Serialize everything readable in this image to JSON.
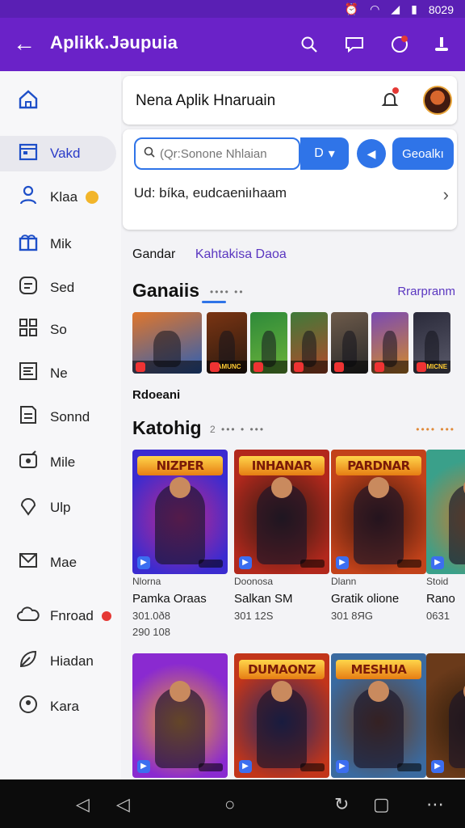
{
  "status_bar": {
    "time": "8029"
  },
  "app_bar": {
    "title": "Aplikk.Jəupuia"
  },
  "sidebar": {
    "items": [
      {
        "label": "",
        "icon": "home-icon"
      },
      {
        "label": "Vakd",
        "icon": "calendar-icon",
        "active": true
      },
      {
        "label": "Klaa",
        "icon": "person-icon",
        "dot": "#f2b52a"
      },
      {
        "label": "Mik",
        "icon": "gift-icon"
      },
      {
        "label": "Sed",
        "icon": "chat-icon"
      },
      {
        "label": "So",
        "icon": "grid-icon"
      },
      {
        "label": "Ne",
        "icon": "list-icon"
      },
      {
        "label": "Sonnd",
        "icon": "document-icon"
      },
      {
        "label": "Mile",
        "icon": "tv-icon"
      },
      {
        "label": "Ulp",
        "icon": "pin-icon"
      },
      {
        "label": "Mae",
        "icon": "mail-icon"
      },
      {
        "label": "Fnroad",
        "icon": "cloud-icon",
        "dot": "#e53935"
      },
      {
        "label": "Hiadan",
        "icon": "leaf-icon"
      },
      {
        "label": "Kara",
        "icon": "location-icon"
      }
    ]
  },
  "header_card": {
    "title": "Nena Aplik Hnaruain"
  },
  "search": {
    "placeholder": "(Qr:Sonone Nhlaian",
    "dropdown_label": "D",
    "primary_button": "Geoalkı",
    "suggestion": "Ud: bíka, eudcaeniıhaam"
  },
  "chips": {
    "first": "Gandar",
    "second": "Kahtakisa Daoa"
  },
  "section_games": {
    "heading": "Ganaiis",
    "sub": "•••• ••",
    "more": "Rrarpranm"
  },
  "thumbnails": [
    {
      "caption": "",
      "bg1": "#e0762b",
      "bg2": "#2c5fb5"
    },
    {
      "caption": "SAMUNC",
      "bg1": "#7a3412",
      "bg2": "#2b1a10"
    },
    {
      "caption": "",
      "bg1": "#2e8a3a",
      "bg2": "#6bb23a"
    },
    {
      "caption": "",
      "bg1": "#3f7a3a",
      "bg2": "#b24a2a"
    },
    {
      "caption": "",
      "bg1": "#6d5a4a",
      "bg2": "#2a2a2a"
    },
    {
      "caption": "",
      "bg1": "#7a4ab5",
      "bg2": "#d28a2a"
    },
    {
      "caption": "JIUMICNE",
      "bg1": "#2a2a3a",
      "bg2": "#5a5a6a"
    }
  ],
  "recent_label": "Rdoeani",
  "section_catalog": {
    "heading": "Katohig",
    "sub": "2 ••• • •••",
    "sub_right": "•••• •••"
  },
  "games": [
    {
      "logo": "NIZPER",
      "category": "Nlorna",
      "name": "Pamka Oraas",
      "downloads": "301.0ð8",
      "size": "290 108",
      "bg1": "#3b2bd0",
      "bg2": "#c22a8a"
    },
    {
      "logo": "INHANAR",
      "category": "Doonosa",
      "name": "Salkan SM",
      "downloads": "301 12S",
      "size": "",
      "bg1": "#b2281c",
      "bg2": "#2a1a14"
    },
    {
      "logo": "PARDNAR",
      "category": "Dlann",
      "name": "Gratik olione",
      "downloads": "301 8ЯG",
      "size": "",
      "bg1": "#c2421a",
      "bg2": "#3a140c"
    },
    {
      "logo": "",
      "category": "Stoid",
      "name": "Rano",
      "downloads": "0631",
      "size": "",
      "bg1": "#3aa08a",
      "bg2": "#d27a2a"
    },
    {
      "logo": "",
      "category": "",
      "name": "",
      "downloads": "",
      "size": "",
      "bg1": "#8a2ad0",
      "bg2": "#f0a22a"
    },
    {
      "logo": "DUMAONZ",
      "category": "",
      "name": "",
      "downloads": "",
      "size": "",
      "bg1": "#c2351a",
      "bg2": "#1a2a6a"
    },
    {
      "logo": "MESHUA",
      "category": "",
      "name": "",
      "downloads": "",
      "size": "",
      "bg1": "#3a6aa0",
      "bg2": "#6a3a1a"
    },
    {
      "logo": "",
      "category": "",
      "name": "",
      "downloads": "",
      "size": "",
      "bg1": "#6a3a1a",
      "bg2": "#2a1a0a"
    }
  ],
  "colors": {
    "primary": "#6a22c8",
    "accent": "#2f74e8",
    "link": "#5a36c0"
  }
}
